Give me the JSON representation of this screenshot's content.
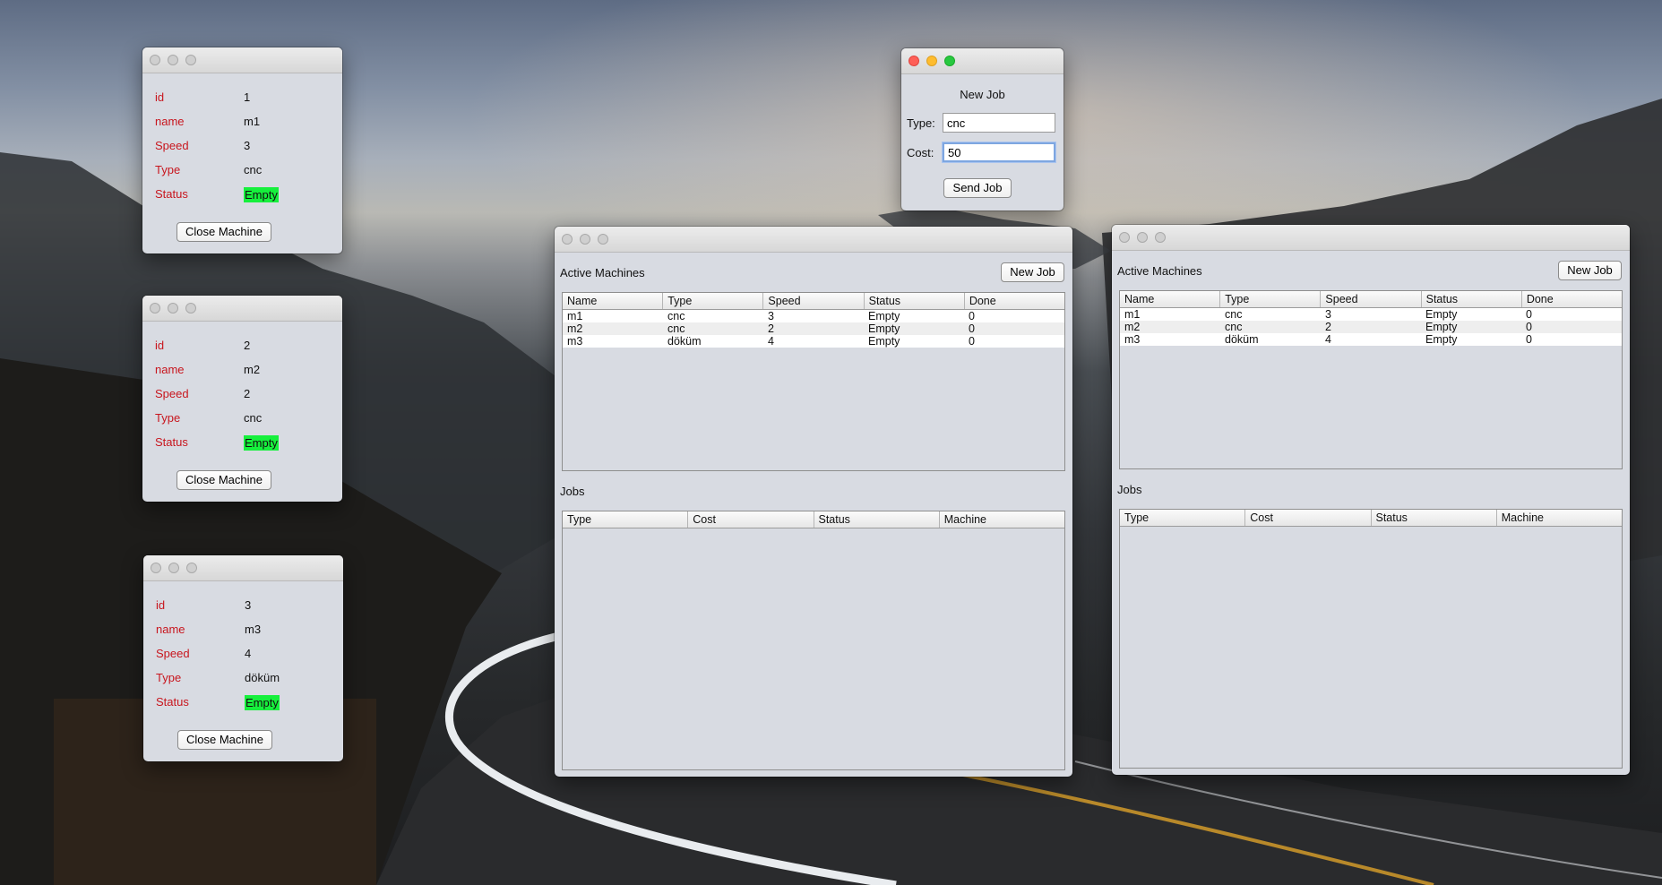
{
  "machine_windows": [
    {
      "fields": [
        {
          "key": "id",
          "value": "1"
        },
        {
          "key": "name",
          "value": "m1"
        },
        {
          "key": "Speed",
          "value": "3"
        },
        {
          "key": "Type",
          "value": "cnc"
        },
        {
          "key": "Status",
          "value": "Empty"
        }
      ],
      "close_button": "Close Machine"
    },
    {
      "fields": [
        {
          "key": "id",
          "value": "2"
        },
        {
          "key": "name",
          "value": "m2"
        },
        {
          "key": "Speed",
          "value": "2"
        },
        {
          "key": "Type",
          "value": "cnc"
        },
        {
          "key": "Status",
          "value": "Empty"
        }
      ],
      "close_button": "Close Machine"
    },
    {
      "fields": [
        {
          "key": "id",
          "value": "3"
        },
        {
          "key": "name",
          "value": "m3"
        },
        {
          "key": "Speed",
          "value": "4"
        },
        {
          "key": "Type",
          "value": "döküm"
        },
        {
          "key": "Status",
          "value": "Empty"
        }
      ],
      "close_button": "Close Machine"
    }
  ],
  "new_job_dialog": {
    "title": "New Job",
    "type_label": "Type:",
    "type_value": "cnc",
    "cost_label": "Cost:",
    "cost_value": "50",
    "send_button": "Send Job"
  },
  "server_windows": [
    {
      "active_label": "Active Machines",
      "new_job_button": "New Job",
      "machines_columns": [
        "Name",
        "Type",
        "Speed",
        "Status",
        "Done"
      ],
      "machines_rows": [
        [
          "m1",
          "cnc",
          "3",
          "Empty",
          "0"
        ],
        [
          "m2",
          "cnc",
          "2",
          "Empty",
          "0"
        ],
        [
          "m3",
          "döküm",
          "4",
          "Empty",
          "0"
        ]
      ],
      "jobs_label": "Jobs",
      "jobs_columns": [
        "Type",
        "Cost",
        "Status",
        "Machine"
      ]
    },
    {
      "active_label": "Active Machines",
      "new_job_button": "New Job",
      "machines_columns": [
        "Name",
        "Type",
        "Speed",
        "Status",
        "Done"
      ],
      "machines_rows": [
        [
          "m1",
          "cnc",
          "3",
          "Empty",
          "0"
        ],
        [
          "m2",
          "cnc",
          "2",
          "Empty",
          "0"
        ],
        [
          "m3",
          "döküm",
          "4",
          "Empty",
          "0"
        ]
      ],
      "jobs_label": "Jobs",
      "jobs_columns": [
        "Type",
        "Cost",
        "Status",
        "Machine"
      ]
    }
  ],
  "colors": {
    "key_label": "#c8161e",
    "status_badge": "#16f03c",
    "window_bg": "#d8dbe2"
  }
}
